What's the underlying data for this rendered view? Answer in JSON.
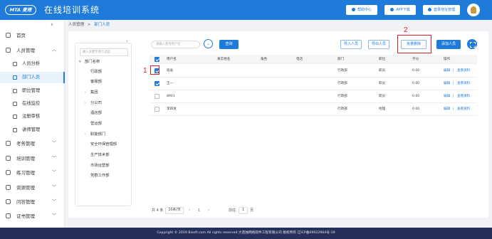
{
  "header": {
    "logo_text": "MTA 麦塔",
    "title": "在线培训系统",
    "buttons": [
      {
        "label": "帮助中心",
        "icon": "help-icon"
      },
      {
        "label": "APP下载",
        "icon": "phone-icon"
      },
      {
        "label": "登录地址管理",
        "icon": "link-icon"
      }
    ]
  },
  "sidebar": {
    "items": [
      {
        "label": "首页",
        "icon": "home-icon"
      },
      {
        "label": "人员管理",
        "icon": "user-icon",
        "expanded": true
      },
      {
        "label": "人员分析",
        "icon": "chart-icon"
      },
      {
        "label": "部门人员",
        "icon": "org-icon",
        "active": true
      },
      {
        "label": "职位管理",
        "icon": "position-icon"
      },
      {
        "label": "在线监控",
        "icon": "monitor-icon"
      },
      {
        "label": "注册审核",
        "icon": "audit-icon"
      },
      {
        "label": "讲师管理",
        "icon": "teacher-icon"
      },
      {
        "label": "考务管理",
        "icon": "exam-icon"
      },
      {
        "label": "培训管理",
        "icon": "training-icon"
      },
      {
        "label": "练习管理",
        "icon": "practice-icon"
      },
      {
        "label": "资源管理",
        "icon": "resource-icon"
      },
      {
        "label": "问答管理",
        "icon": "qa-icon"
      },
      {
        "label": "证书管理",
        "icon": "certificate-icon"
      }
    ]
  },
  "breadcrumb": {
    "parent": "人员管理",
    "sep": ">",
    "current": "部门人员"
  },
  "tree": {
    "search_placeholder": "输入关键字进行过滤",
    "nodes": [
      {
        "label": "部门名称",
        "arrow": "▾"
      },
      {
        "label": "行政部",
        "arrow": ""
      },
      {
        "label": "客服部",
        "arrow": ""
      },
      {
        "label": "集团",
        "arrow": "›"
      },
      {
        "label": "分公司",
        "arrow": "›"
      },
      {
        "label": "酒店部",
        "arrow": ""
      },
      {
        "label": "营运部",
        "arrow": ""
      },
      {
        "label": "职能部门",
        "arrow": "›"
      },
      {
        "label": "安全环保管理部",
        "arrow": ""
      },
      {
        "label": "生产技术部",
        "arrow": ""
      },
      {
        "label": "市场运营部",
        "arrow": ""
      },
      {
        "label": "党群工作部",
        "arrow": ""
      }
    ]
  },
  "toolbar": {
    "search_placeholder": "请输入查询用户名",
    "query_label": "查询",
    "import_label": "导入人员",
    "export_label": "导出人员",
    "batch_delete_label": "批量删除",
    "add_label": "添加人员"
  },
  "annotations": {
    "num1": "1",
    "num2": "2"
  },
  "table": {
    "columns": [
      "用户名",
      "真实姓名",
      "角色",
      "电话",
      "部门",
      "职位",
      "学分",
      "操作"
    ],
    "rows": [
      {
        "checked": true,
        "username": "宿舍",
        "realname": "",
        "role": "",
        "phone": "",
        "dept": "行政部",
        "position": "职员",
        "credit": "0.00",
        "edit": "编辑",
        "sep": "|",
        "view": "查看资料"
      },
      {
        "checked": true,
        "username": "王一",
        "realname": "",
        "role": "",
        "phone": "",
        "dept": "行政部",
        "position": "职员",
        "credit": "0.00",
        "edit": "编辑",
        "sep": "|",
        "view": "查看资料"
      },
      {
        "checked": false,
        "username": "8901",
        "realname": "",
        "role": "",
        "phone": "",
        "dept": "行政部",
        "position": "职员",
        "credit": "0.00",
        "edit": "编辑",
        "sep": "|",
        "view": "查看资料"
      },
      {
        "checked": false,
        "username": "李四发",
        "realname": "",
        "role": "",
        "phone": "",
        "dept": "行政部",
        "position": "经理",
        "credit": "0.00",
        "edit": "编辑",
        "sep": "|",
        "view": "查看资料"
      }
    ]
  },
  "pagination": {
    "total": "共 4 条",
    "page_size": "10条/页",
    "prev": "‹",
    "page": "1",
    "next": "›",
    "goto_label": "前往",
    "goto_value": "1",
    "page_unit": "页"
  },
  "footer": {
    "text": "Copyright © 2019 Bisoft.com All rights reserved 大连独网络软件工程有限公司 版权所有 辽ICP备09022904号-19"
  },
  "colors": {
    "primary": "#1e7bd9",
    "footer_bg": "#242f5a",
    "annotation": "#e02020"
  }
}
